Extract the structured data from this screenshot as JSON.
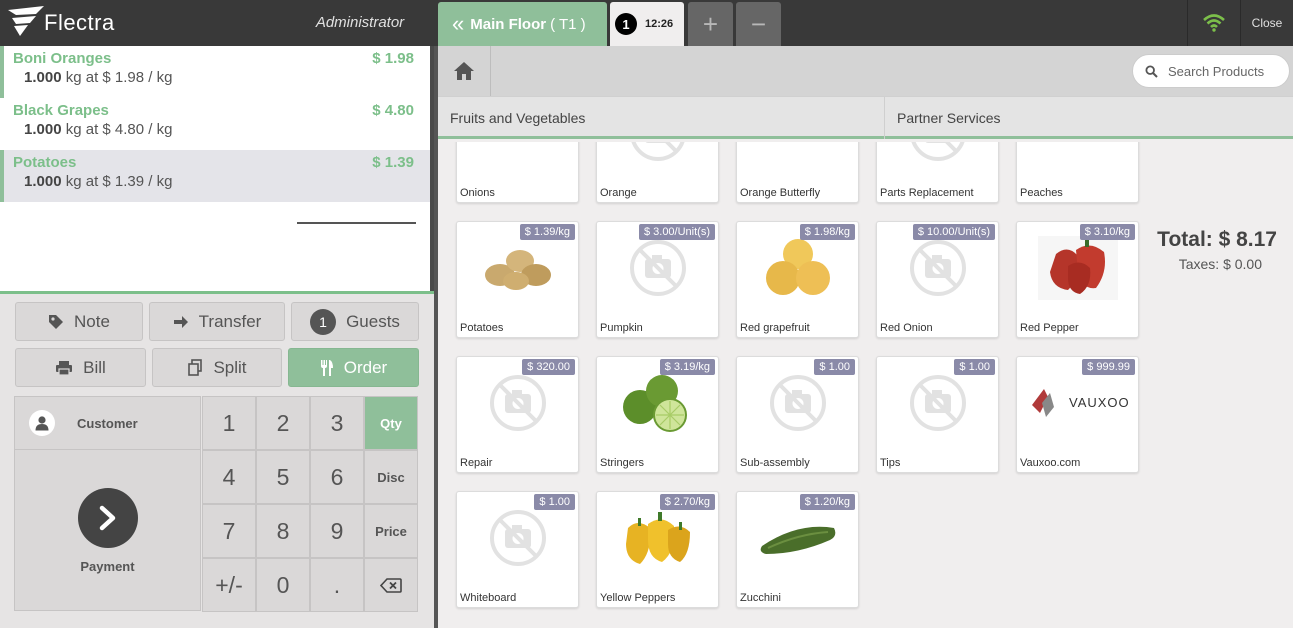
{
  "topbar": {
    "logo_text": "Flectra",
    "user": "Administrator",
    "floor_label": "Main Floor",
    "table_label": "( T1 )",
    "order_number": "1",
    "order_time": "12:26",
    "plus": "+",
    "minus": "−",
    "close_label": "Close",
    "wifi_color": "#7cbf4a"
  },
  "orderlines": [
    {
      "name": "Boni Oranges",
      "price": "$ 1.98",
      "qty": "1.000",
      "unit_info": "kg at $ 1.98 / kg"
    },
    {
      "name": "Black Grapes",
      "price": "$ 4.80",
      "qty": "1.000",
      "unit_info": "kg at $ 4.80 / kg"
    },
    {
      "name": "Potatoes",
      "price": "$ 1.39",
      "qty": "1.000",
      "unit_info": "kg at $ 1.39 / kg"
    }
  ],
  "summary": {
    "total": "Total: $ 8.17",
    "taxes": "Taxes: $ 0.00"
  },
  "controls": {
    "note": "Note",
    "transfer": "Transfer",
    "guests_count": "1",
    "guests": "Guests",
    "bill": "Bill",
    "split": "Split",
    "order": "Order",
    "customer": "Customer",
    "payment": "Payment"
  },
  "numpad": {
    "keys": [
      "1",
      "2",
      "3",
      "4",
      "5",
      "6",
      "7",
      "8",
      "9",
      "+/-",
      "0",
      "."
    ],
    "modes": [
      "Qty",
      "Disc",
      "Price"
    ],
    "active_mode": "Qty"
  },
  "search": {
    "placeholder": "Search Products"
  },
  "categories": [
    "Fruits and Vegetables",
    "Partner Services"
  ],
  "products": [
    {
      "name": "Onions",
      "price": "",
      "icon": "onion"
    },
    {
      "name": "Orange",
      "price": "",
      "icon": "no-image"
    },
    {
      "name": "Orange Butterfly",
      "price": "",
      "icon": "orange"
    },
    {
      "name": "Parts Replacement",
      "price": "",
      "icon": "no-image"
    },
    {
      "name": "Peaches",
      "price": "",
      "icon": "peach"
    },
    {
      "name": "Potatoes",
      "price": "$ 1.39/kg",
      "icon": "potato"
    },
    {
      "name": "Pumpkin",
      "price": "$ 3.00/Unit(s)",
      "icon": "no-image"
    },
    {
      "name": "Red grapefruit",
      "price": "$ 1.98/kg",
      "icon": "grapefruit"
    },
    {
      "name": "Red Onion",
      "price": "$ 10.00/Unit(s)",
      "icon": "no-image"
    },
    {
      "name": "Red Pepper",
      "price": "$ 3.10/kg",
      "icon": "red-pepper"
    },
    {
      "name": "Repair",
      "price": "$ 320.00",
      "icon": "no-image"
    },
    {
      "name": "Stringers",
      "price": "$ 3.19/kg",
      "icon": "lime"
    },
    {
      "name": "Sub-assembly",
      "price": "$ 1.00",
      "icon": "no-image"
    },
    {
      "name": "Tips",
      "price": "$ 1.00",
      "icon": "no-image"
    },
    {
      "name": "Vauxoo.com",
      "price": "$ 999.99",
      "icon": "vauxoo-logo",
      "logo_text": "VAUXOO"
    },
    {
      "name": "Whiteboard",
      "price": "$ 1.00",
      "icon": "no-image"
    },
    {
      "name": "Yellow Peppers",
      "price": "$ 2.70/kg",
      "icon": "yellow-pepper"
    },
    {
      "name": "Zucchini",
      "price": "$ 1.20/kg",
      "icon": "zucchini"
    }
  ]
}
